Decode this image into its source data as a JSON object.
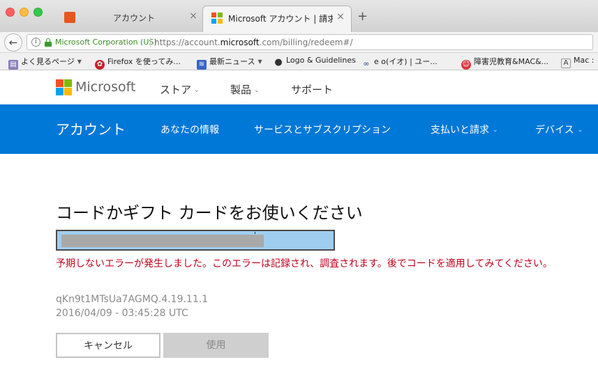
{
  "browser": {
    "tabs": [
      {
        "title": "アカウント",
        "active": false,
        "close": "×"
      },
      {
        "title": "Microsoft アカウント | 請求...",
        "active": true,
        "close": "×"
      }
    ],
    "new_tab": "+",
    "identity": "Microsoft Corporation (US)",
    "url_prefix": "https://account.",
    "url_domain": "microsoft",
    "url_suffix": ".com/billing/redeem#/",
    "back": "←",
    "info": "i"
  },
  "bookmarks": [
    {
      "label": "よく見るページ",
      "dropdown": true
    },
    {
      "label": "Firefox を使ってみ...",
      "dropdown": false
    },
    {
      "label": "最新ニュース",
      "dropdown": true
    },
    {
      "label": "Logo & Guidelines",
      "dropdown": false
    },
    {
      "label": "e o(イオ) | ユー...",
      "dropdown": false
    },
    {
      "label": "障害児教育&MAC&...",
      "dropdown": false
    },
    {
      "label": "Mac :",
      "dropdown": false
    }
  ],
  "ms_header": {
    "wordmark": "Microsoft",
    "nav": [
      {
        "label": "ストア",
        "chevron": "⌄"
      },
      {
        "label": "製品",
        "chevron": "⌄"
      },
      {
        "label": "サポート"
      }
    ]
  },
  "account_bar": {
    "title": "アカウント",
    "nav": [
      {
        "label": "あなたの情報"
      },
      {
        "label": "サービスとサブスクリプション"
      },
      {
        "label": "支払いと請求",
        "chevron": "⌄"
      },
      {
        "label": "デバイス",
        "chevron": "⌄"
      }
    ]
  },
  "content": {
    "title": "コードかギフト カードをお使いください",
    "error": "予期しないエラーが発生しました。このエラーは記録され、調査されます。後でコードを適用してみてください。",
    "trace_id": "qKn9t1MTsUa7AGMQ.4.19.11.1",
    "timestamp": "2016/04/09 - 03:45:28 UTC",
    "cancel_label": "キャンセル",
    "use_label": "使用"
  },
  "colors": {
    "ms_blue": "#0078d7",
    "error_red": "#c2001c",
    "logo_red": "#f25022",
    "logo_green": "#7fba00",
    "logo_blue": "#00a4ef",
    "logo_yellow": "#ffb900"
  }
}
